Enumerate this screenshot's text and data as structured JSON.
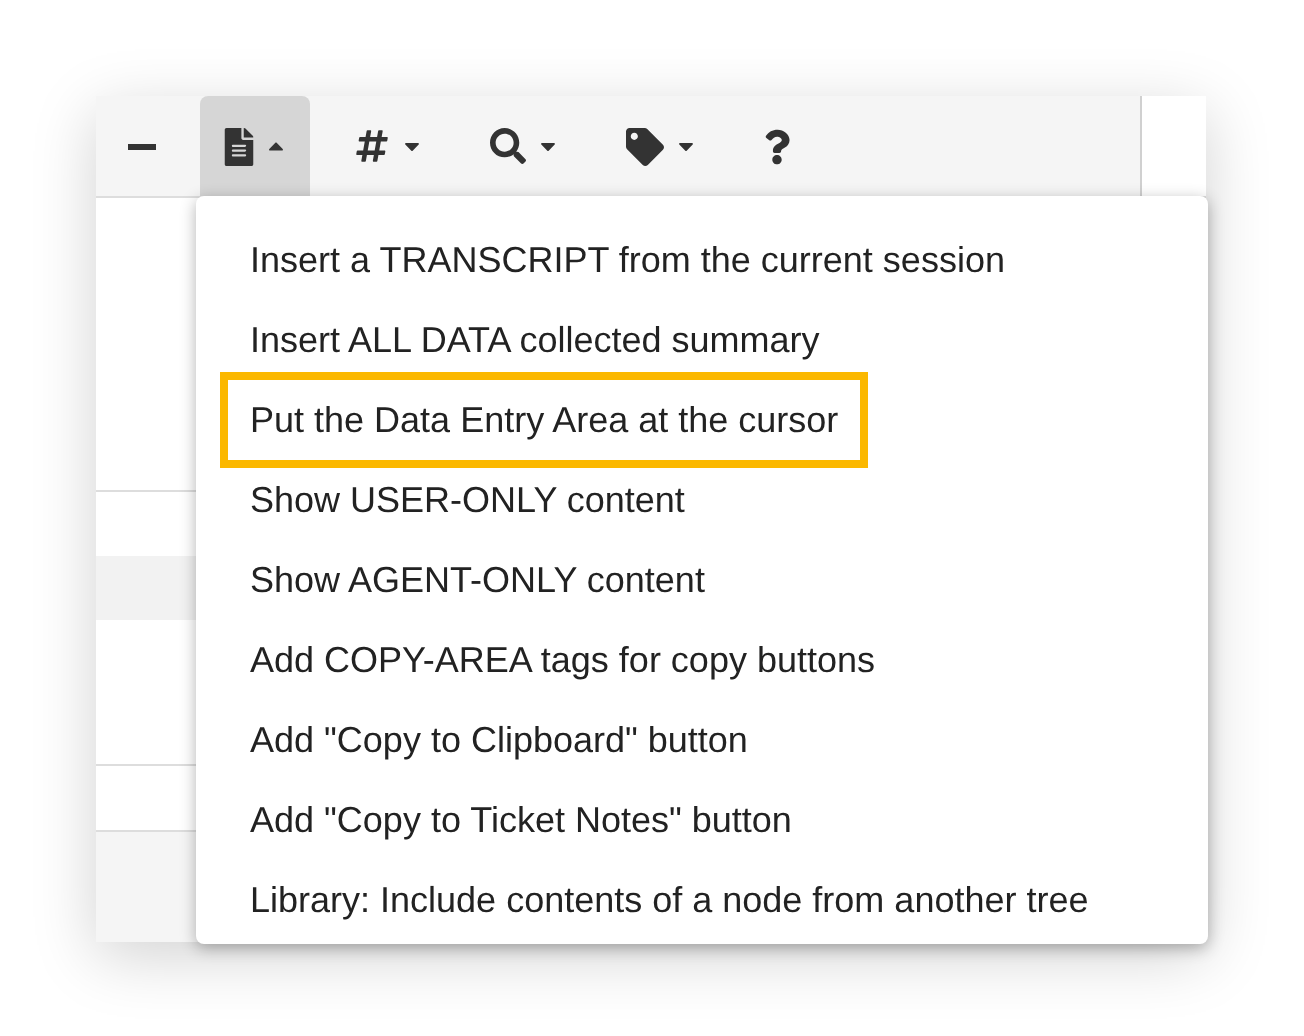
{
  "toolbar": {
    "buttons": [
      {
        "kind": "minus",
        "selected": false,
        "has_dropdown": false
      },
      {
        "kind": "document",
        "selected": true,
        "has_dropdown": true,
        "expanded": true
      },
      {
        "kind": "hash",
        "selected": false,
        "has_dropdown": true,
        "expanded": false
      },
      {
        "kind": "search",
        "selected": false,
        "has_dropdown": true,
        "expanded": false
      },
      {
        "kind": "tag",
        "selected": false,
        "has_dropdown": true,
        "expanded": false
      },
      {
        "kind": "help",
        "selected": false,
        "has_dropdown": false
      }
    ]
  },
  "menu": {
    "items": [
      {
        "label": "Insert a TRANSCRIPT from the current session",
        "highlighted": false
      },
      {
        "label": "Insert ALL DATA collected summary",
        "highlighted": false
      },
      {
        "label": "Put the Data Entry Area at the cursor",
        "highlighted": true
      },
      {
        "label": "Show USER-ONLY content",
        "highlighted": false
      },
      {
        "label": "Show AGENT-ONLY content",
        "highlighted": false
      },
      {
        "label": "Add COPY-AREA tags for copy buttons",
        "highlighted": false
      },
      {
        "label": "Add \"Copy to Clipboard\" button",
        "highlighted": false
      },
      {
        "label": "Add \"Copy to Ticket Notes\" button",
        "highlighted": false
      },
      {
        "label": "Library: Include contents of a node from another tree",
        "highlighted": false
      }
    ]
  }
}
